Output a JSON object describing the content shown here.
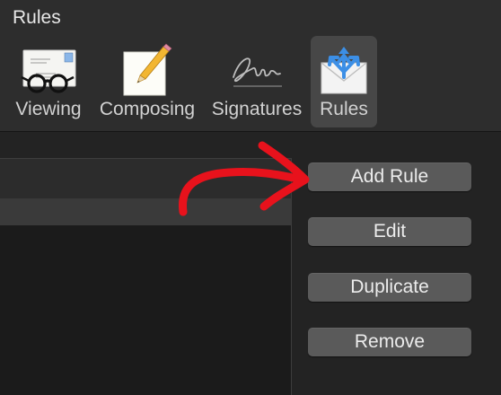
{
  "window": {
    "title": "Rules"
  },
  "tabs": [
    {
      "label": "Viewing",
      "icon": "glasses-envelope-icon"
    },
    {
      "label": "Composing",
      "icon": "pencil-paper-icon"
    },
    {
      "label": "Signatures",
      "icon": "signature-icon"
    },
    {
      "label": "Rules",
      "icon": "rules-envelope-icon",
      "selected": true
    }
  ],
  "buttons": {
    "add": "Add Rule",
    "edit": "Edit",
    "duplicate": "Duplicate",
    "remove": "Remove"
  },
  "colors": {
    "annotation_arrow": "#e8121c",
    "rules_icon_blue": "#3c8fe6",
    "button_bg": "#5a5a5a",
    "selected_tab_bg": "#474747"
  }
}
